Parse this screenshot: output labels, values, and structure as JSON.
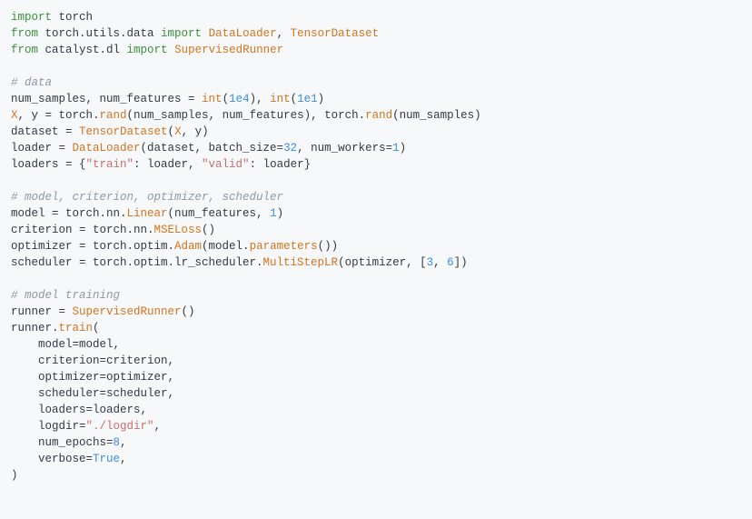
{
  "code": {
    "lines": [
      {
        "tokens": [
          {
            "cls": "kw",
            "t": "import"
          },
          {
            "cls": "op",
            "t": " torch"
          }
        ]
      },
      {
        "tokens": [
          {
            "cls": "kw",
            "t": "from"
          },
          {
            "cls": "op",
            "t": " torch.utils.data "
          },
          {
            "cls": "kw",
            "t": "import"
          },
          {
            "cls": "op",
            "t": " "
          },
          {
            "cls": "blt",
            "t": "DataLoader"
          },
          {
            "cls": "op",
            "t": ", "
          },
          {
            "cls": "blt",
            "t": "TensorDataset"
          }
        ]
      },
      {
        "tokens": [
          {
            "cls": "kw",
            "t": "from"
          },
          {
            "cls": "op",
            "t": " catalyst.dl "
          },
          {
            "cls": "kw",
            "t": "import"
          },
          {
            "cls": "op",
            "t": " "
          },
          {
            "cls": "blt",
            "t": "SupervisedRunner"
          }
        ]
      },
      {
        "tokens": [
          {
            "cls": "op",
            "t": ""
          }
        ]
      },
      {
        "tokens": [
          {
            "cls": "cmt",
            "t": "# data"
          }
        ]
      },
      {
        "tokens": [
          {
            "cls": "op",
            "t": "num_samples, num_features = "
          },
          {
            "cls": "blt",
            "t": "int"
          },
          {
            "cls": "op",
            "t": "("
          },
          {
            "cls": "num",
            "t": "1e4"
          },
          {
            "cls": "op",
            "t": "), "
          },
          {
            "cls": "blt",
            "t": "int"
          },
          {
            "cls": "op",
            "t": "("
          },
          {
            "cls": "num",
            "t": "1e1"
          },
          {
            "cls": "op",
            "t": ")"
          }
        ]
      },
      {
        "tokens": [
          {
            "cls": "blt",
            "t": "X"
          },
          {
            "cls": "op",
            "t": ", y = torch."
          },
          {
            "cls": "blt",
            "t": "rand"
          },
          {
            "cls": "op",
            "t": "(num_samples, num_features), torch."
          },
          {
            "cls": "blt",
            "t": "rand"
          },
          {
            "cls": "op",
            "t": "(num_samples)"
          }
        ]
      },
      {
        "tokens": [
          {
            "cls": "op",
            "t": "dataset = "
          },
          {
            "cls": "blt",
            "t": "TensorDataset"
          },
          {
            "cls": "op",
            "t": "("
          },
          {
            "cls": "blt",
            "t": "X"
          },
          {
            "cls": "op",
            "t": ", y)"
          }
        ]
      },
      {
        "tokens": [
          {
            "cls": "op",
            "t": "loader = "
          },
          {
            "cls": "blt",
            "t": "DataLoader"
          },
          {
            "cls": "op",
            "t": "(dataset, batch_size="
          },
          {
            "cls": "num",
            "t": "32"
          },
          {
            "cls": "op",
            "t": ", num_workers="
          },
          {
            "cls": "num",
            "t": "1"
          },
          {
            "cls": "op",
            "t": ")"
          }
        ]
      },
      {
        "tokens": [
          {
            "cls": "op",
            "t": "loaders = {"
          },
          {
            "cls": "str",
            "t": "\"train\""
          },
          {
            "cls": "op",
            "t": ": loader, "
          },
          {
            "cls": "str",
            "t": "\"valid\""
          },
          {
            "cls": "op",
            "t": ": loader}"
          }
        ]
      },
      {
        "tokens": [
          {
            "cls": "op",
            "t": ""
          }
        ]
      },
      {
        "tokens": [
          {
            "cls": "cmt",
            "t": "# model, criterion, optimizer, scheduler"
          }
        ]
      },
      {
        "tokens": [
          {
            "cls": "op",
            "t": "model = torch.nn."
          },
          {
            "cls": "blt",
            "t": "Linear"
          },
          {
            "cls": "op",
            "t": "(num_features, "
          },
          {
            "cls": "num",
            "t": "1"
          },
          {
            "cls": "op",
            "t": ")"
          }
        ]
      },
      {
        "tokens": [
          {
            "cls": "op",
            "t": "criterion = torch.nn."
          },
          {
            "cls": "blt",
            "t": "MSELoss"
          },
          {
            "cls": "op",
            "t": "()"
          }
        ]
      },
      {
        "tokens": [
          {
            "cls": "op",
            "t": "optimizer = torch.optim."
          },
          {
            "cls": "blt",
            "t": "Adam"
          },
          {
            "cls": "op",
            "t": "(model."
          },
          {
            "cls": "blt",
            "t": "parameters"
          },
          {
            "cls": "op",
            "t": "())"
          }
        ]
      },
      {
        "tokens": [
          {
            "cls": "op",
            "t": "scheduler = torch.optim.lr_scheduler."
          },
          {
            "cls": "blt",
            "t": "MultiStepLR"
          },
          {
            "cls": "op",
            "t": "(optimizer, ["
          },
          {
            "cls": "num",
            "t": "3"
          },
          {
            "cls": "op",
            "t": ", "
          },
          {
            "cls": "num",
            "t": "6"
          },
          {
            "cls": "op",
            "t": "])"
          }
        ]
      },
      {
        "tokens": [
          {
            "cls": "op",
            "t": ""
          }
        ]
      },
      {
        "tokens": [
          {
            "cls": "cmt",
            "t": "# model training"
          }
        ]
      },
      {
        "tokens": [
          {
            "cls": "op",
            "t": "runner = "
          },
          {
            "cls": "blt",
            "t": "SupervisedRunner"
          },
          {
            "cls": "op",
            "t": "()"
          }
        ]
      },
      {
        "tokens": [
          {
            "cls": "op",
            "t": "runner."
          },
          {
            "cls": "blt",
            "t": "train"
          },
          {
            "cls": "op",
            "t": "("
          }
        ]
      },
      {
        "tokens": [
          {
            "cls": "op",
            "t": "    model=model,"
          }
        ]
      },
      {
        "tokens": [
          {
            "cls": "op",
            "t": "    criterion=criterion,"
          }
        ]
      },
      {
        "tokens": [
          {
            "cls": "op",
            "t": "    optimizer=optimizer,"
          }
        ]
      },
      {
        "tokens": [
          {
            "cls": "op",
            "t": "    scheduler=scheduler,"
          }
        ]
      },
      {
        "tokens": [
          {
            "cls": "op",
            "t": "    loaders=loaders,"
          }
        ]
      },
      {
        "tokens": [
          {
            "cls": "op",
            "t": "    logdir="
          },
          {
            "cls": "str",
            "t": "\"./logdir\""
          },
          {
            "cls": "op",
            "t": ","
          }
        ]
      },
      {
        "tokens": [
          {
            "cls": "op",
            "t": "    num_epochs="
          },
          {
            "cls": "num",
            "t": "8"
          },
          {
            "cls": "op",
            "t": ","
          }
        ]
      },
      {
        "tokens": [
          {
            "cls": "op",
            "t": "    verbose="
          },
          {
            "cls": "num",
            "t": "True"
          },
          {
            "cls": "op",
            "t": ","
          }
        ]
      },
      {
        "tokens": [
          {
            "cls": "op",
            "t": ")"
          }
        ]
      }
    ]
  }
}
